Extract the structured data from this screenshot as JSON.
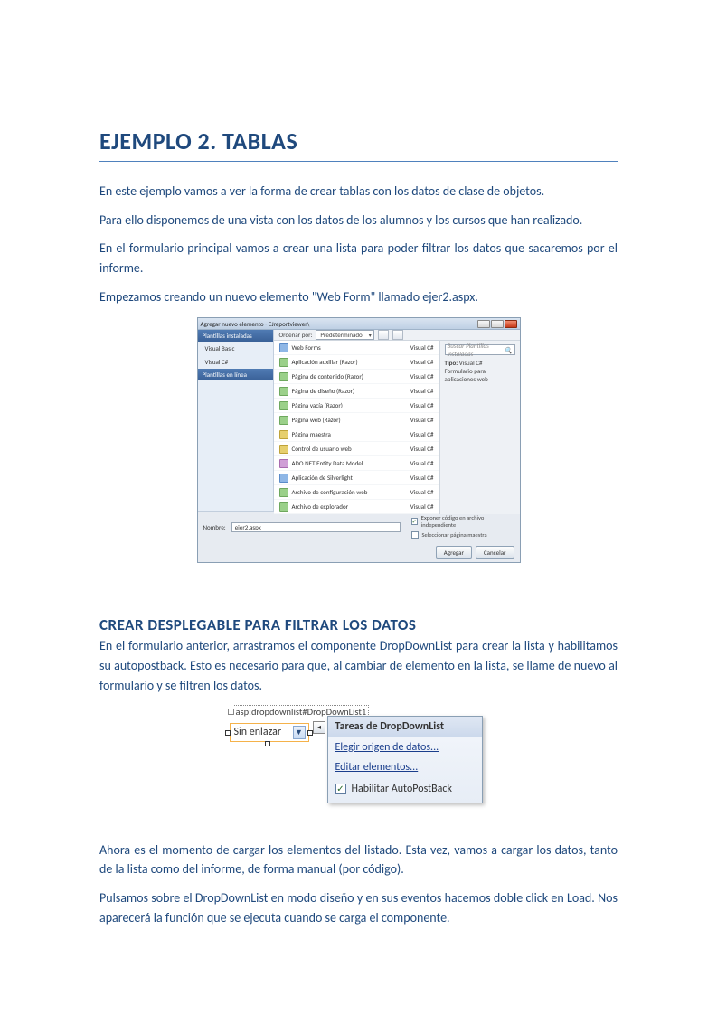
{
  "h1": "EJEMPLO 2. TABLAS",
  "p1": "En este ejemplo vamos  a ver la forma de crear tablas con los datos de clase de objetos.",
  "p2": "Para ello disponemos de una vista con los datos de los alumnos y los cursos que han realizado.",
  "p3": "En el formulario principal vamos a crear una lista para poder filtrar los datos que sacaremos por el informe.",
  "p4": "Empezamos creando un nuevo elemento \"Web Form\" llamado ejer2.aspx.",
  "h2": "CREAR DESPLEGABLE PARA FILTRAR LOS DATOS",
  "p5": "En el formulario anterior, arrastramos el componente DropDownList para crear la lista y habilitamos su autopostback. Esto es necesario para que, al cambiar de elemento en la lista, se llame de nuevo al formulario y se filtren los datos.",
  "p6": "Ahora es el momento de cargar los elementos del listado. Esta vez, vamos a cargar los datos, tanto de la lista como del informe, de forma manual (por código).",
  "p7": "Pulsamos sobre el DropDownList en modo diseño y en sus eventos hacemos doble click en Load. Nos aparecerá la función que se ejecuta cuando se carga el componente.",
  "dialog": {
    "title": "Agregar nuevo elemento - EJreportviewer\\",
    "side_header": "Plantillas instaladas",
    "side_items": [
      "Visual Basic",
      "Visual C#"
    ],
    "side_header2": "Plantillas en línea",
    "sort_label": "Ordenar por:",
    "sort_value": "Predeterminado",
    "search_placeholder": "Buscar Plantillas instaladas",
    "right_type_label": "Tipo:",
    "right_type_value": "Visual C#",
    "right_desc": "Formulario para aplicaciones web",
    "lang": "Visual C#",
    "templates": [
      "Web Forms",
      "Aplicación auxiliar (Razor)",
      "Página de contenido (Razor)",
      "Página de diseño (Razor)",
      "Página vacía (Razor)",
      "Página web (Razor)",
      "Página maestra",
      "Control de usuario web",
      "ADO.NET Entity Data Model",
      "Aplicación de Silverlight",
      "Archivo de configuración web",
      "Archivo de explorador"
    ],
    "name_label": "Nombre:",
    "name_value": "ejer2.aspx",
    "chk1": "Exponer código en archivo independiente",
    "chk2": "Seleccionar página maestra",
    "btn_add": "Agregar",
    "btn_cancel": "Cancelar"
  },
  "ddl": {
    "marker": "asp:dropdownlist#DropDownList1",
    "value": "Sin enlazar",
    "panel_title": "Tareas de DropDownList",
    "item1": "Elegir origen de datos...",
    "item2": "Editar elementos...",
    "chk_label": "Habilitar AutoPostBack"
  }
}
